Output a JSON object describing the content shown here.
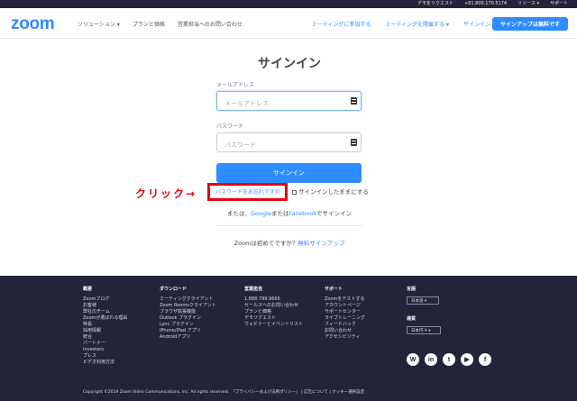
{
  "topbar": {
    "links": [
      "デモをリクエスト",
      "+81.800.170.5174",
      "リソース ▾",
      "サポート"
    ]
  },
  "nav": {
    "logo": "zoom",
    "left_items": [
      "ソリューション ▾",
      "プランと価格",
      "営業担当へのお問い合わせ"
    ],
    "right_items": [
      "ミーティングに参加する",
      "ミーティングを開催する ▾",
      "サインイン"
    ],
    "signup_label": "サインアップは無料です"
  },
  "signin": {
    "title": "サインイン",
    "email_label": "メールアドレス",
    "email_placeholder": "メールアドレス",
    "password_label": "パスワード",
    "password_placeholder": "パスワード",
    "submit_label": "サインイン",
    "forgot_label": "パスワードをお忘れですか",
    "keep_signed_label": "サインインしたままにする",
    "alt_prefix": "または、",
    "alt_google": "Google",
    "alt_mid": "または",
    "alt_facebook": "Facebook",
    "alt_suffix": "でサインイン",
    "new_prefix": "Zoomは初めてですか？",
    "new_link": "無料サインアップ"
  },
  "annotation": {
    "click_label": "クリック→",
    "color": "#e8000f"
  },
  "footer": {
    "columns": [
      {
        "head": "概要",
        "items": [
          "Zoomブログ",
          "お客様",
          "弊社のチーム",
          "Zoomが選ばれる理由",
          "特長",
          "採用情報",
          "統合",
          "パートナー",
          "Investors",
          "プレス",
          "ビデオ利用方法"
        ]
      },
      {
        "head": "ダウンロード",
        "items": [
          "ミーティングクライアント",
          "Zoom Roomsクライアント",
          "ブラウザ拡張機能",
          "Outlook プラグイン",
          "Lync プラグイン",
          "iPhone/iPad アプリ",
          "Androidアプリ"
        ]
      },
      {
        "head": "営業担当",
        "items": [
          "1.888.799.9666",
          "セールスへのお問い合わせ",
          "プランと価格",
          "デモリクエスト",
          "ウェビナーとイベントリスト"
        ]
      },
      {
        "head": "サポート",
        "items": [
          "Zoomをテストする",
          "アカウントページ",
          "サポートセンター",
          "ライブトレーニング",
          "フィードバック",
          "お問い合わせ",
          "アクセシビリティ"
        ]
      }
    ],
    "language_head": "言語",
    "language_value": "日本語 ▾",
    "currency_head": "通貨",
    "currency_value": "日本円 ¥ ▾",
    "social_icons": [
      "wordpress-icon",
      "linkedin-icon",
      "twitter-icon",
      "youtube-icon",
      "facebook-icon"
    ],
    "copyright": "Copyright ©2019 Zoom Video Communications, Inc. All rights reserved.　「プライバシーおよび法務ポリシー」 | 広告について | クッキー選択設定"
  },
  "colors": {
    "brand": "#2d8cff",
    "footer_bg": "#23243a",
    "annotation_red": "#e8000f"
  }
}
